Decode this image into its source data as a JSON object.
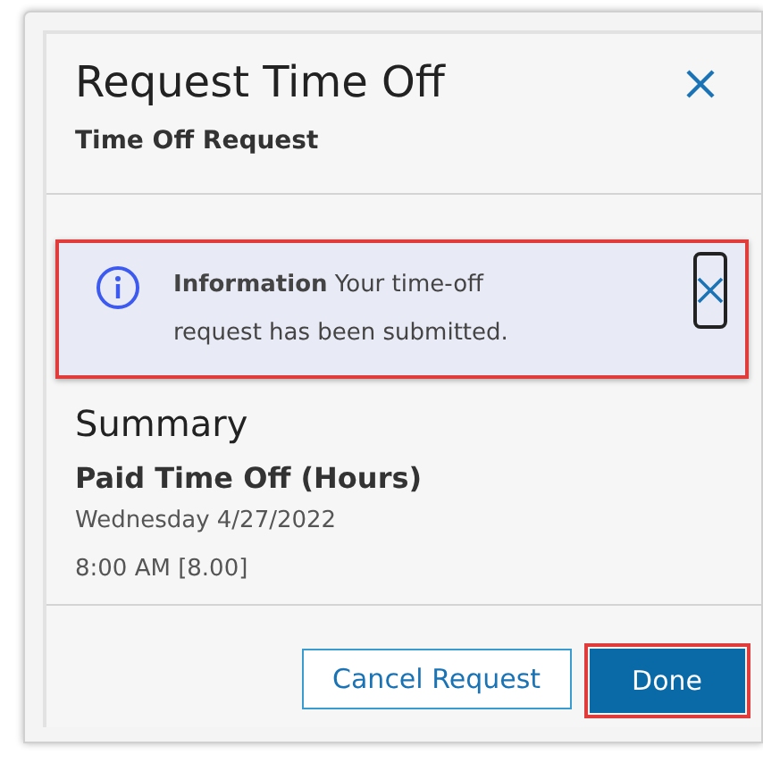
{
  "dialog": {
    "title": "Request Time Off",
    "subtitle": "Time Off Request"
  },
  "alert": {
    "message": "**Information** Your time-off request has been submitted."
  },
  "summary": {
    "heading": "Summary",
    "type": "Paid Time Off (Hours)",
    "date": "Wednesday 4/27/2022",
    "time": "8:00 AM [8.00]"
  },
  "buttons": [
    {
      "label": "Cancel Request",
      "kind": "secondary"
    },
    {
      "label": "Done",
      "kind": "primary"
    }
  ]
}
